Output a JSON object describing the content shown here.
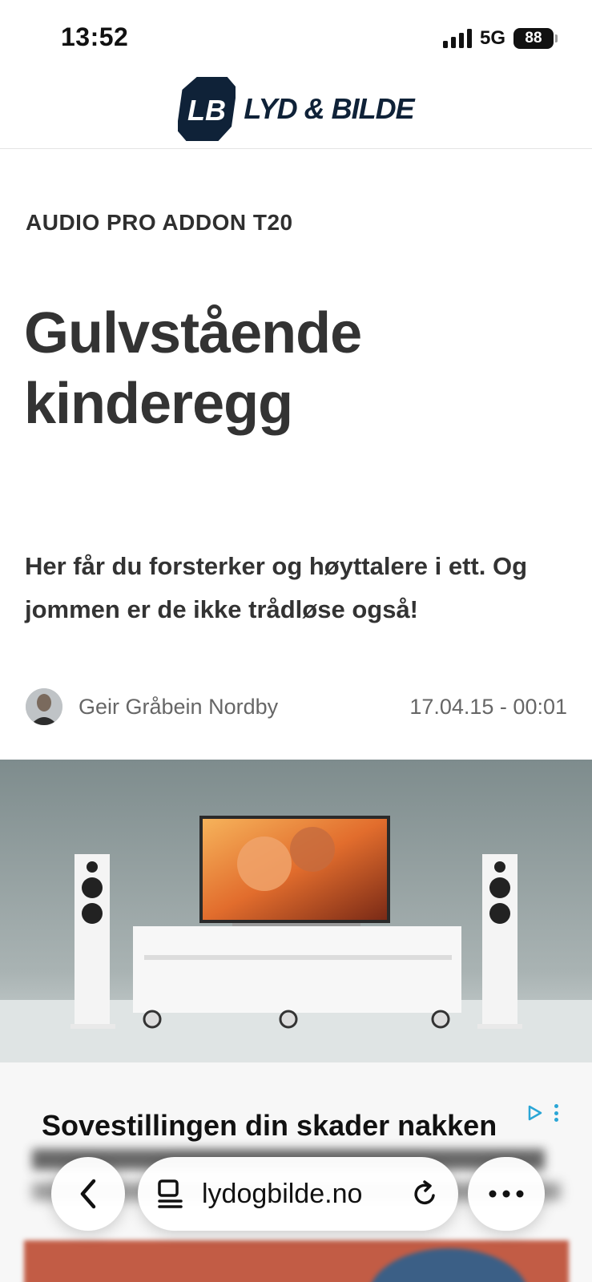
{
  "status_bar": {
    "time": "13:52",
    "network": "5G",
    "battery": "88"
  },
  "logo": {
    "mark": "LB",
    "name": "LYD & BILDE"
  },
  "article": {
    "kicker": "AUDIO PRO ADDON T20",
    "headline": "Gulvstående kinderegg",
    "lead": "Her får du forsterker og høyttalere i ett. Og jommen er de ikke trådløse også!",
    "author": "Geir Gråbein Nordby",
    "date": "17.04.15 - 00:01"
  },
  "ad": {
    "title": "Sovestillingen din skader nakken"
  },
  "browser": {
    "url": "lydogbilde.no"
  },
  "icons": [
    "signal-icon",
    "battery-icon",
    "back-icon",
    "tabs-icon",
    "reload-icon",
    "more-icon",
    "ad-choices-icon",
    "ad-menu-icon"
  ],
  "colors": {
    "brand": "#0f2238",
    "text": "#333333",
    "meta": "#666666",
    "ad_accent": "#2aa6d6"
  }
}
